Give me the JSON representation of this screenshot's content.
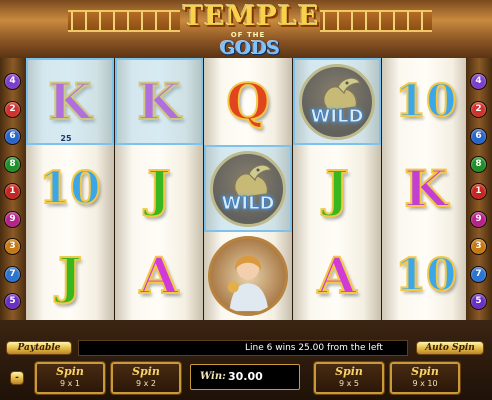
{
  "logo": {
    "top": "TEMPLE",
    "middle": "OF THE",
    "bottom": "GODS"
  },
  "line_numbers": {
    "left": [
      {
        "n": "4",
        "color": "#7b3fc9"
      },
      {
        "n": "2",
        "color": "#d0332b"
      },
      {
        "n": "6",
        "color": "#2a66c8"
      },
      {
        "n": "8",
        "color": "#1f8f2a"
      },
      {
        "n": "1",
        "color": "#c7261e"
      },
      {
        "n": "9",
        "color": "#b7228b"
      },
      {
        "n": "3",
        "color": "#c47a16"
      },
      {
        "n": "7",
        "color": "#2b74d0"
      },
      {
        "n": "5",
        "color": "#6a2fc3"
      }
    ],
    "right": [
      {
        "n": "4",
        "color": "#7b3fc9"
      },
      {
        "n": "2",
        "color": "#d0332b"
      },
      {
        "n": "6",
        "color": "#2a66c8"
      },
      {
        "n": "8",
        "color": "#1f8f2a"
      },
      {
        "n": "1",
        "color": "#c7261e"
      },
      {
        "n": "9",
        "color": "#b7228b"
      },
      {
        "n": "3",
        "color": "#c47a16"
      },
      {
        "n": "7",
        "color": "#2b74d0"
      },
      {
        "n": "5",
        "color": "#6a2fc3"
      }
    ]
  },
  "reels": [
    [
      "K",
      "10",
      "J"
    ],
    [
      "K",
      "J",
      "A"
    ],
    [
      "Q",
      "WILD",
      "GODDESS"
    ],
    [
      "WILD",
      "J",
      "A"
    ],
    [
      "10",
      "K",
      "10"
    ]
  ],
  "win_line_amount": "25",
  "controls": {
    "paytable": "Paytable",
    "message": "Line 6 wins 25.00 from the left",
    "autospin": "Auto Spin",
    "small_button": "-",
    "win_caption": "Win:",
    "win_value": "30.00",
    "spin_buttons": [
      {
        "label": "Spin",
        "sub": "9 x 1"
      },
      {
        "label": "Spin",
        "sub": "9 x 2"
      },
      {
        "label": "Spin",
        "sub": "9 x 5"
      },
      {
        "label": "Spin",
        "sub": "9 x 10"
      }
    ]
  },
  "colors": {
    "highlight": "#7cc2ec",
    "gold": "#e8bf4a"
  }
}
